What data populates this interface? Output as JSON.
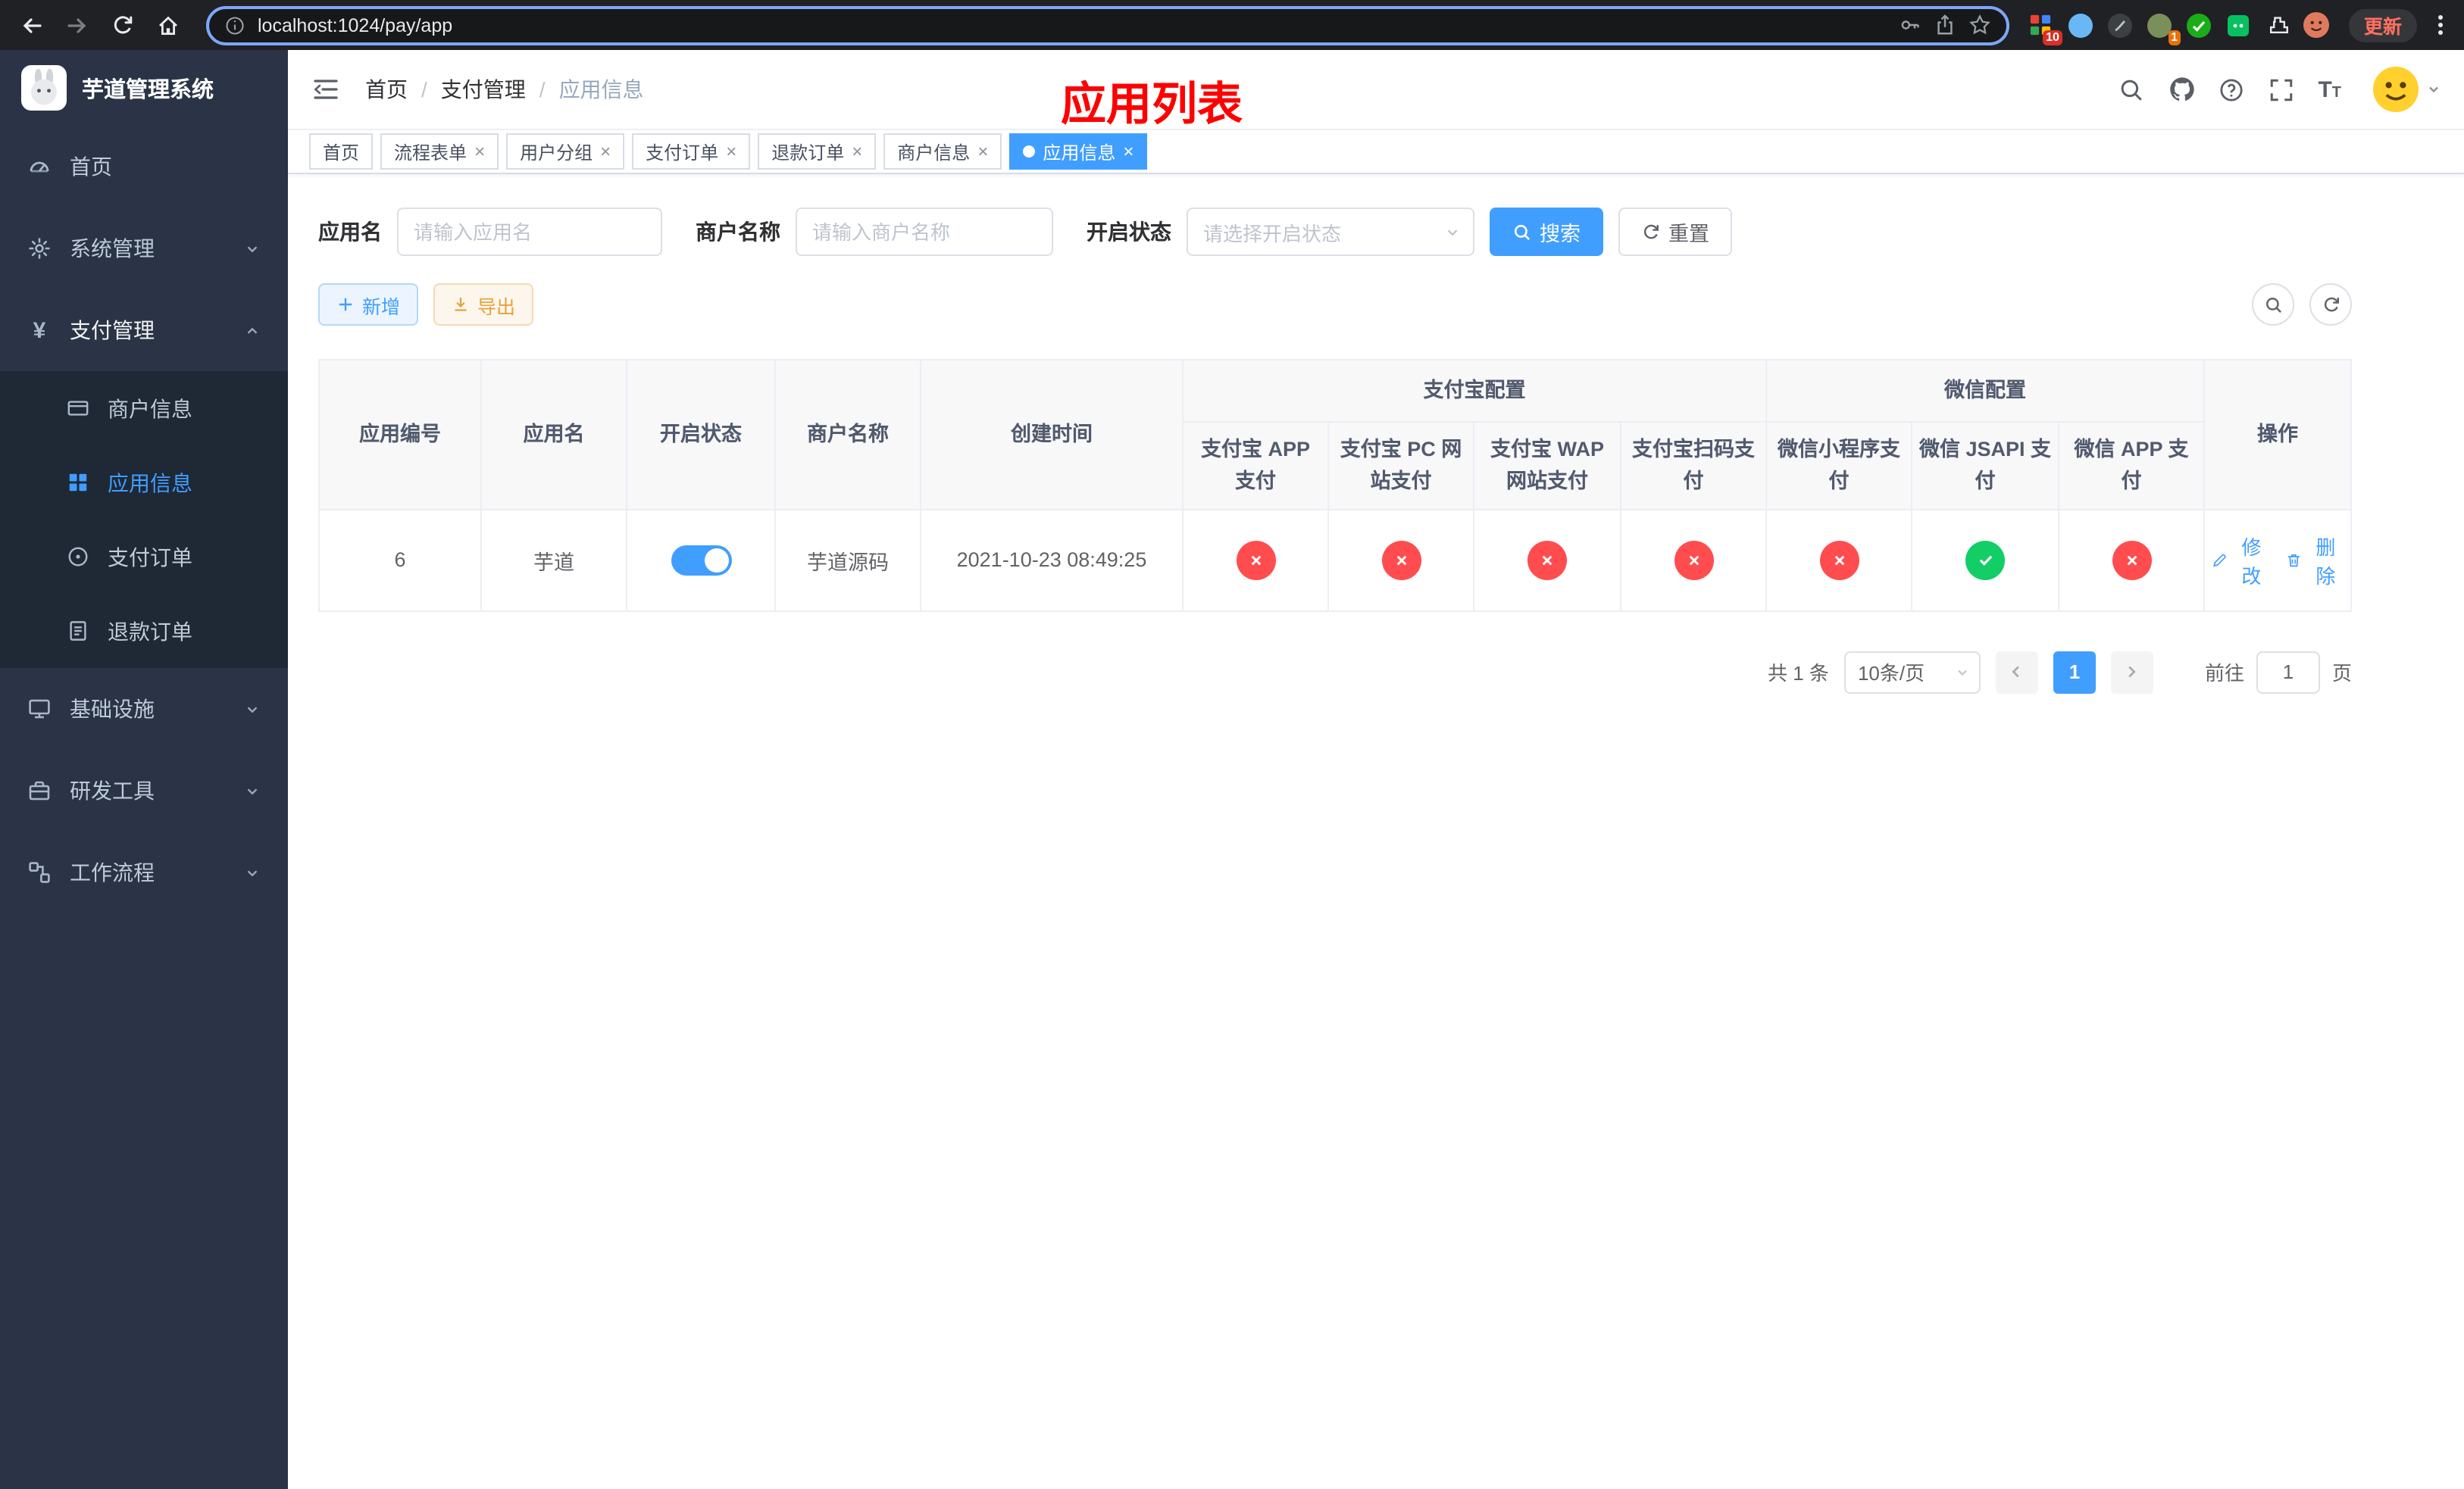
{
  "colors": {
    "accent": "#409eff",
    "danger": "#ff4d4f",
    "success": "#13ce66",
    "warning": "#e6a23c"
  },
  "browser": {
    "url": "localhost:1024/pay/app",
    "update_label": "更新",
    "ext_badges": {
      "grid": "10",
      "avatar": "1"
    }
  },
  "sidebar": {
    "title": "芋道管理系统",
    "items": [
      {
        "label": "首页"
      },
      {
        "label": "系统管理"
      },
      {
        "label": "支付管理"
      },
      {
        "label": "基础设施"
      },
      {
        "label": "研发工具"
      },
      {
        "label": "工作流程"
      }
    ],
    "payment_children": [
      {
        "label": "商户信息"
      },
      {
        "label": "应用信息"
      },
      {
        "label": "支付订单"
      },
      {
        "label": "退款订单"
      }
    ]
  },
  "navbar": {
    "breadcrumb": [
      "首页",
      "支付管理",
      "应用信息"
    ],
    "annotation": "应用列表"
  },
  "tabs": [
    {
      "label": "首页"
    },
    {
      "label": "流程表单"
    },
    {
      "label": "用户分组"
    },
    {
      "label": "支付订单"
    },
    {
      "label": "退款订单"
    },
    {
      "label": "商户信息"
    },
    {
      "label": "应用信息"
    }
  ],
  "filters": {
    "app_name": {
      "label": "应用名",
      "placeholder": "请输入应用名"
    },
    "merchant_name": {
      "label": "商户名称",
      "placeholder": "请输入商户名称"
    },
    "status": {
      "label": "开启状态",
      "placeholder": "请选择开启状态"
    },
    "search": "搜索",
    "reset": "重置"
  },
  "toolbar": {
    "add": "新增",
    "export": "导出"
  },
  "table": {
    "group_headers": {
      "alipay": "支付宝配置",
      "wechat": "微信配置"
    },
    "columns": [
      "应用编号",
      "应用名",
      "开启状态",
      "商户名称",
      "创建时间",
      "支付宝 APP 支付",
      "支付宝 PC 网站支付",
      "支付宝 WAP 网站支付",
      "支付宝扫码支付",
      "微信小程序支付",
      "微信 JSAPI 支付",
      "微信 APP 支付",
      "操作"
    ],
    "rows": [
      {
        "id": "6",
        "name": "芋道",
        "enabled": true,
        "merchant": "芋道源码",
        "created_at": "2021-10-23 08:49:25",
        "channels": {
          "alipay_app": false,
          "alipay_pc": false,
          "alipay_wap": false,
          "alipay_qr": false,
          "wx_lite": false,
          "wx_jsapi": true,
          "wx_app": false
        },
        "actions": {
          "edit": "修改",
          "delete": "删除"
        }
      }
    ]
  },
  "pagination": {
    "total": "共 1 条",
    "page_size": "10条/页",
    "page": "1",
    "goto_prefix": "前往",
    "goto_value": "1",
    "goto_suffix": "页"
  }
}
